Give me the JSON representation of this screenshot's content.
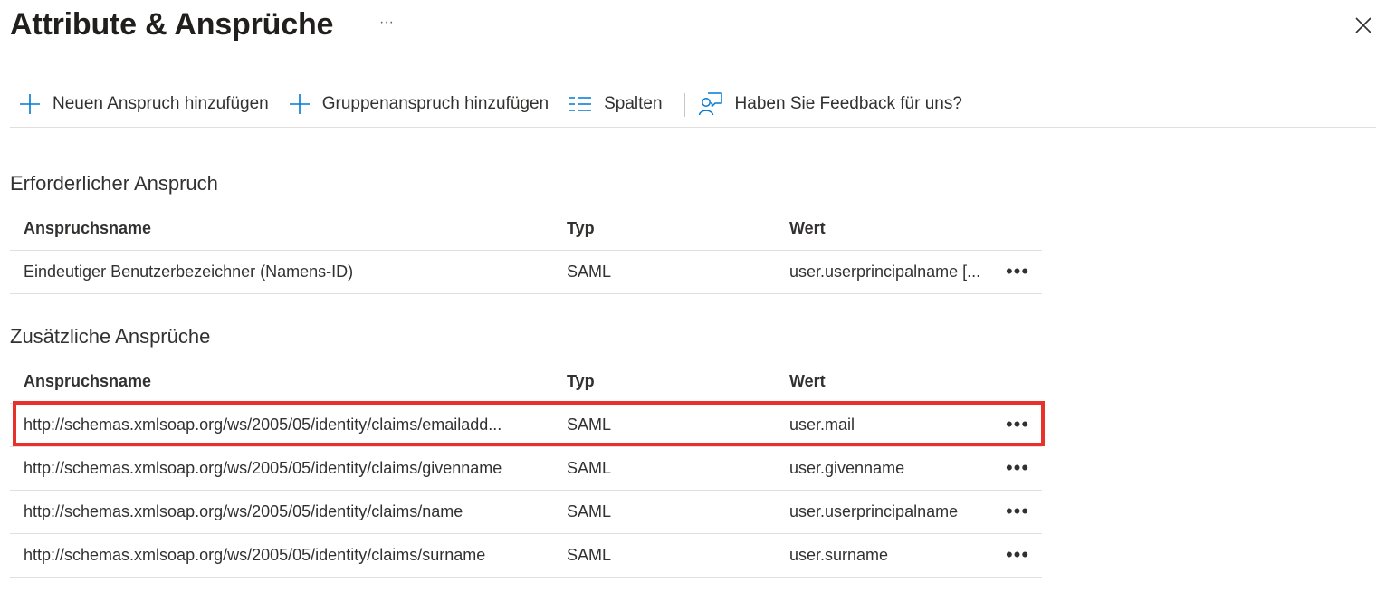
{
  "header": {
    "title": "Attribute & Ansprüche",
    "more_label": "···"
  },
  "toolbar": {
    "add_claim_label": "Neuen Anspruch hinzufügen",
    "add_group_claim_label": "Gruppenanspruch hinzufügen",
    "columns_label": "Spalten",
    "feedback_label": "Haben Sie Feedback für uns?"
  },
  "required": {
    "title": "Erforderlicher Anspruch",
    "columns": [
      "Anspruchsname",
      "Typ",
      "Wert"
    ],
    "rows": [
      {
        "name": "Eindeutiger Benutzerbezeichner (Namens-ID)",
        "type": "SAML",
        "value": "user.userprincipalname [..."
      }
    ]
  },
  "additional": {
    "title": "Zusätzliche Ansprüche",
    "columns": [
      "Anspruchsname",
      "Typ",
      "Wert"
    ],
    "rows": [
      {
        "name": "http://schemas.xmlsoap.org/ws/2005/05/identity/claims/emailadd...",
        "type": "SAML",
        "value": "user.mail"
      },
      {
        "name": "http://schemas.xmlsoap.org/ws/2005/05/identity/claims/givenname",
        "type": "SAML",
        "value": "user.givenname"
      },
      {
        "name": "http://schemas.xmlsoap.org/ws/2005/05/identity/claims/name",
        "type": "SAML",
        "value": "user.userprincipalname"
      },
      {
        "name": "http://schemas.xmlsoap.org/ws/2005/05/identity/claims/surname",
        "type": "SAML",
        "value": "user.surname"
      }
    ]
  },
  "row_more_label": "•••",
  "colors": {
    "accent": "#0078d4",
    "highlight": "#e8312a",
    "divider": "#e1dfdd"
  }
}
